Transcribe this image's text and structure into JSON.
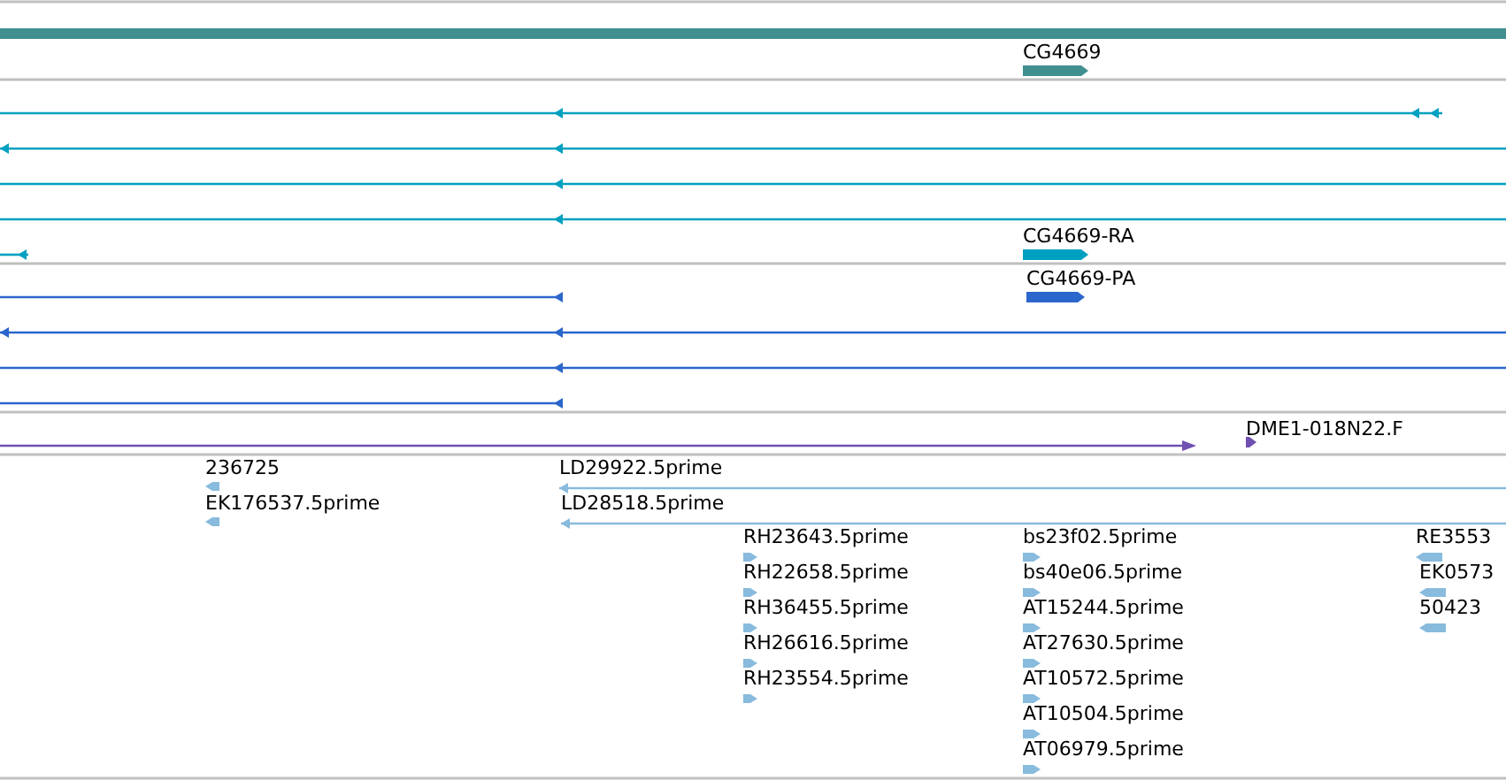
{
  "tracks": [
    {
      "kind": "gene",
      "features": [
        {
          "label": "CG4669",
          "reverse": false
        }
      ]
    },
    {
      "kind": "transcript",
      "features": [
        {
          "label": "CG4669-RA",
          "reverse": false
        }
      ]
    },
    {
      "kind": "protein",
      "features": [
        {
          "label": "CG4669-PA",
          "reverse": false
        }
      ]
    },
    {
      "kind": "clone",
      "features": [
        {
          "label": "DME1-018N22.F",
          "reverse": false
        }
      ]
    },
    {
      "kind": "est",
      "features": [
        {
          "label": "236725",
          "reverse": true
        },
        {
          "label": "LD29922.5prime",
          "reverse": true
        },
        {
          "label": "EK176537.5prime",
          "reverse": true
        },
        {
          "label": "LD28518.5prime",
          "reverse": true
        },
        {
          "label": "RH23643.5prime",
          "reverse": false
        },
        {
          "label": "RH22658.5prime",
          "reverse": false
        },
        {
          "label": "RH36455.5prime",
          "reverse": false
        },
        {
          "label": "RH26616.5prime",
          "reverse": false
        },
        {
          "label": "RH23554.5prime",
          "reverse": false
        },
        {
          "label": "bs23f02.5prime",
          "reverse": false
        },
        {
          "label": "bs40e06.5prime",
          "reverse": false
        },
        {
          "label": "AT15244.5prime",
          "reverse": false
        },
        {
          "label": "AT27630.5prime",
          "reverse": false
        },
        {
          "label": "AT10572.5prime",
          "reverse": false
        },
        {
          "label": "AT10504.5prime",
          "reverse": false
        },
        {
          "label": "AT06979.5prime",
          "reverse": false
        },
        {
          "label": "RE3553",
          "reverse": true
        },
        {
          "label": "EK0573",
          "reverse": true
        },
        {
          "label": "50423",
          "reverse": true
        }
      ]
    }
  ]
}
